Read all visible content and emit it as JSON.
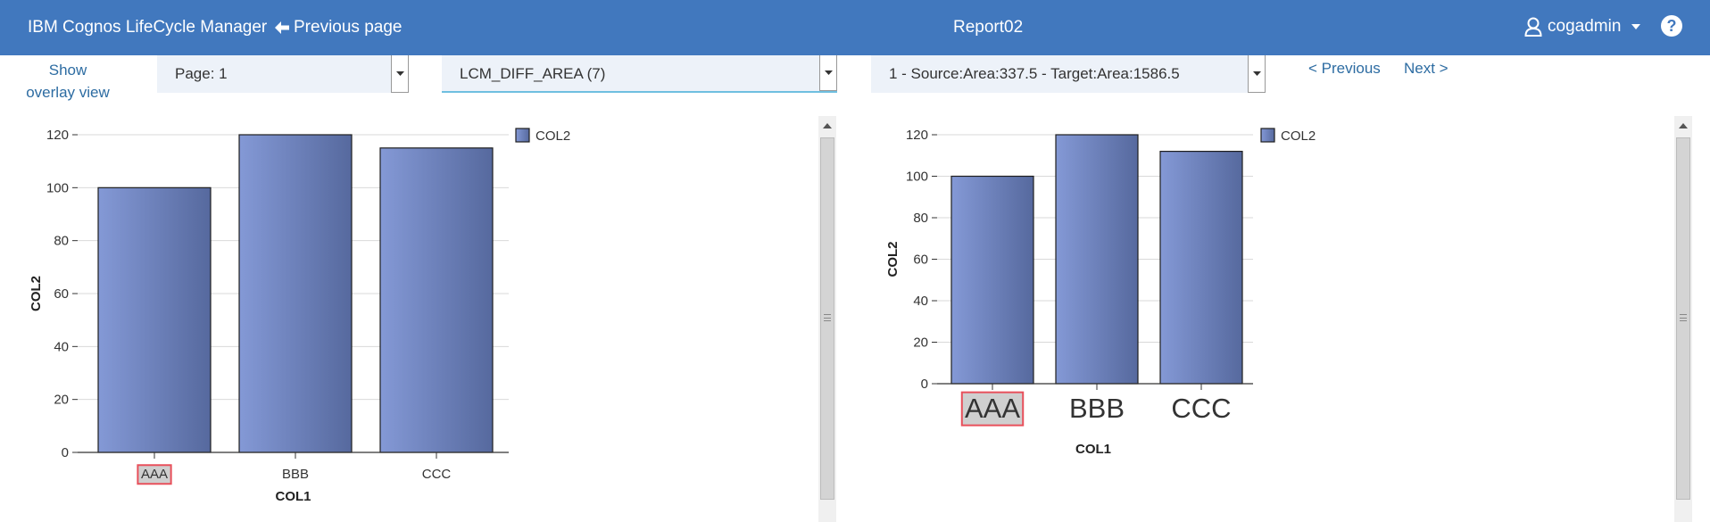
{
  "header": {
    "app_title": "IBM Cognos LifeCycle Manager",
    "previous_page": "Previous page",
    "report_title": "Report02",
    "user": "cogadmin"
  },
  "toolbar": {
    "show_overlay_line1": "Show",
    "show_overlay_line2": "overlay view",
    "page_select": "Page: 1",
    "diff_select": "LCM_DIFF_AREA (7)",
    "source_select": "1 - Source:Area:337.5 - Target:Area:1586.5",
    "previous_link": "< Previous",
    "next_link": "Next >"
  },
  "icons": {
    "back": "arrow-left-icon",
    "user": "user-icon",
    "menu": "caret-down-icon",
    "help": "question-circle-icon",
    "dropdown": "triangle-down-icon"
  },
  "colors": {
    "header_bg": "#4178be",
    "link": "#2d6ca2",
    "bar_light": "#8499d6",
    "bar_dark": "#56699e",
    "highlight_border": "#e8505b",
    "highlight_fill": "#cfcfcf"
  },
  "chart_data": [
    {
      "type": "bar",
      "categories": [
        "AAA",
        "BBB",
        "CCC"
      ],
      "series": [
        {
          "name": "COL2",
          "values": [
            100,
            120,
            115
          ]
        }
      ],
      "xlabel": "COL1",
      "ylabel": "COL2",
      "ylim": [
        0,
        120
      ],
      "yticks": [
        0,
        20,
        40,
        60,
        80,
        100,
        120
      ],
      "legend": "top-right",
      "grid": true,
      "highlighted_category": "AAA"
    },
    {
      "type": "bar",
      "categories": [
        "AAA",
        "BBB",
        "CCC"
      ],
      "series": [
        {
          "name": "COL2",
          "values": [
            100,
            120,
            112
          ]
        }
      ],
      "xlabel": "COL1",
      "ylabel": "COL2",
      "ylim": [
        0,
        120
      ],
      "yticks": [
        0,
        20,
        40,
        60,
        80,
        100,
        120
      ],
      "legend": "top-right",
      "grid": true,
      "highlighted_category": "AAA"
    }
  ]
}
